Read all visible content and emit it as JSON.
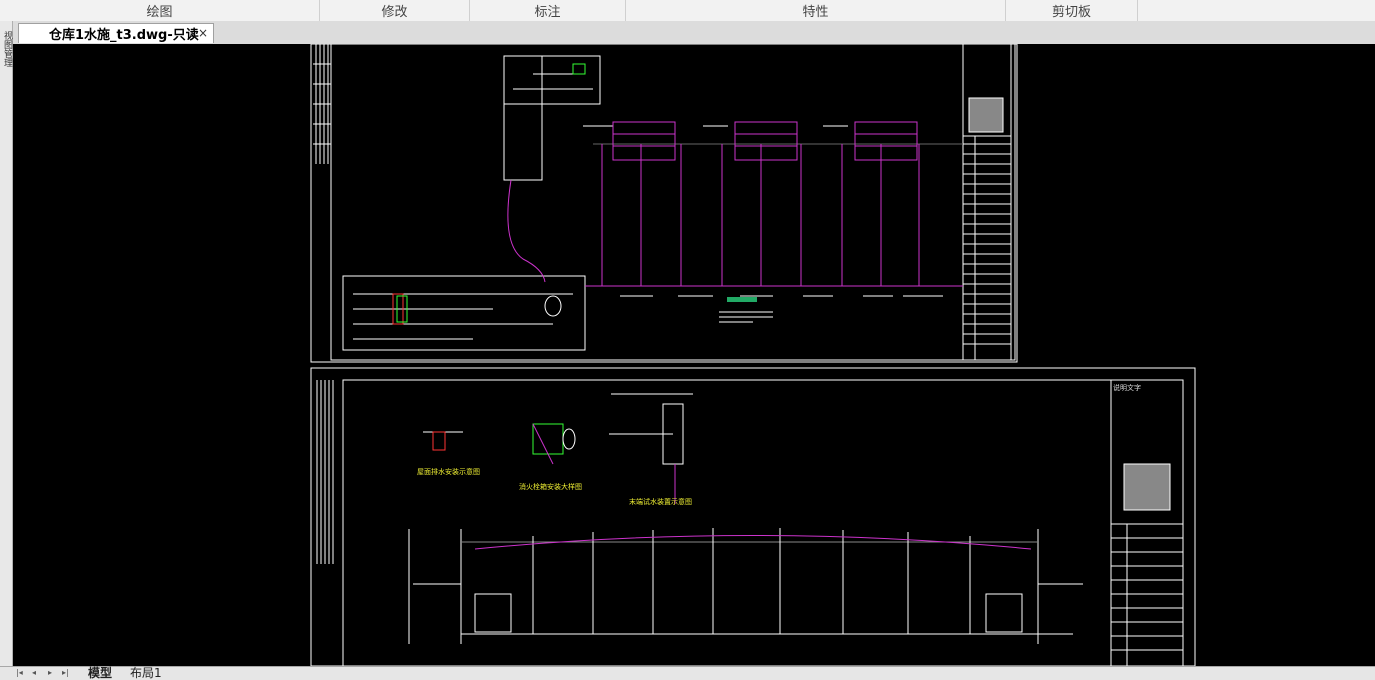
{
  "ribbon": {
    "groups": [
      {
        "label": "绘图"
      },
      {
        "label": "修改"
      },
      {
        "label": "标注"
      },
      {
        "label": "特性"
      },
      {
        "label": "剪切板"
      }
    ]
  },
  "side_strip": {
    "label": "视图管理"
  },
  "document_tab": {
    "title": "仓库1水施_t3.dwg-只读",
    "close_glyph": "×"
  },
  "drawing": {
    "upper_sheet": {
      "title_block_present": true
    },
    "lower_sheet": {
      "header_text": "说明文字",
      "detail_labels": [
        "屋面排水安装示意图",
        "消火栓箱安装大样图",
        "末端试水装置示意图"
      ]
    },
    "colors": {
      "background": "#000000",
      "lines": "#ffffff",
      "pipes": "#cc33cc",
      "accent_red": "#ff3030",
      "accent_green": "#33ff33"
    }
  },
  "status_bar": {
    "nav_buttons": [
      "|◂",
      "◂",
      "▸",
      "▸|"
    ],
    "layout_tabs": [
      {
        "label": "模型",
        "active": true
      },
      {
        "label": "布局1",
        "active": false
      }
    ]
  }
}
